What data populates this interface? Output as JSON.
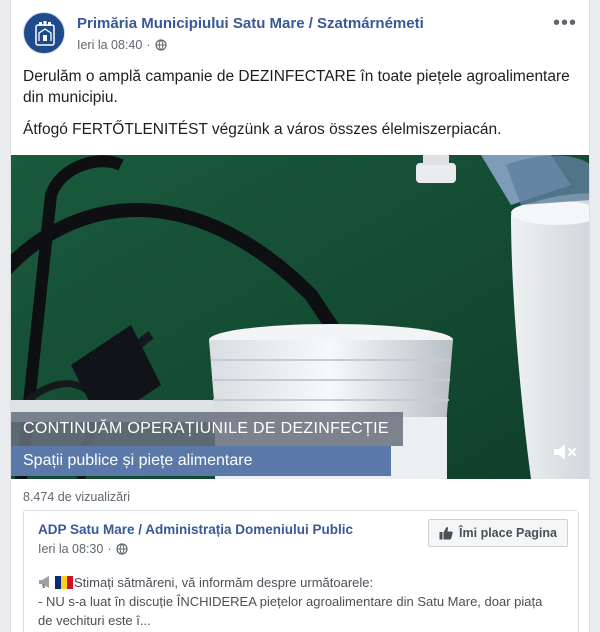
{
  "post": {
    "page_name": "Primăria Municipiului Satu Mare / Szatmárnémeti",
    "timestamp": "Ieri la 08:40",
    "separator": "·",
    "privacy_icon": "globe-icon",
    "more_label": "•••",
    "text_ro": "Derulăm o amplă campanie de DEZINFECTARE în toate piețele agroalimentare din municipiu.",
    "text_hu": "Átfogó FERTŐTLENITÉST végzünk a város összes élelmiszerpiacán."
  },
  "video": {
    "overlay_title": "CONTINUĂM OPERAȚIUNILE DE DEZINFECȚIE",
    "overlay_subtitle": "Spații publice și piețe alimentare",
    "mute_icon": "speaker-muted-icon",
    "views": "8.474 de vizualizări"
  },
  "shared_post": {
    "page_name": "ADP Satu Mare / Administrația Domeniului Public",
    "timestamp": "Ieri la 08:30",
    "separator": "·",
    "like_button_label": "Îmi place Pagina",
    "line1": "Stimați sătmăreni, vă informăm despre următoarele:",
    "line2": "- NU s-a luat în discuție ÎNCHIDEREA piețelor agroalimentare din Satu Mare, doar piața",
    "line3": "de vechituri este î..."
  },
  "colors": {
    "link": "#385898",
    "video_background": "#1c5a3e",
    "overlay_grey": "#69707e",
    "overlay_blue": "#5a79a9"
  }
}
